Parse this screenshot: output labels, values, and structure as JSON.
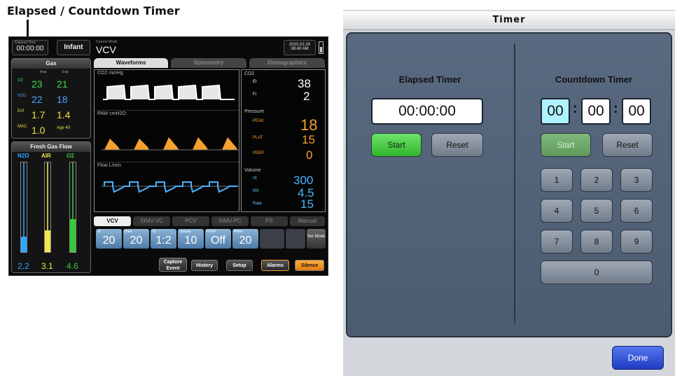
{
  "caption": "Elapsed / Countdown Timer",
  "ventilator": {
    "elapsed_label": "Elapsed Time",
    "elapsed": "00:00:00",
    "patient": "Infant",
    "current_mode_label": "Current Mode",
    "current_mode": "VCV",
    "date": "2015.02.24",
    "time": "08:40 AM",
    "gas": {
      "title": "Gas",
      "col_insp": "Insp",
      "col_exp": "Exp",
      "rows": [
        {
          "label": "O2",
          "insp": "23",
          "exp": "21"
        },
        {
          "label": "N2O",
          "insp": "22",
          "exp": "18"
        },
        {
          "label": "Enf",
          "insp": "1.7",
          "exp": "1.4"
        }
      ],
      "mac_label": "MAC",
      "mac": "1.0",
      "age_label": "Age",
      "age": "40"
    },
    "fresh_gas": {
      "title": "Fresh Gas Flow",
      "items": [
        {
          "name": "N2O",
          "value": "2.2",
          "color": "#2aa8ff",
          "level": 0.17
        },
        {
          "name": "AIR",
          "value": "3.1",
          "color": "#f2e64a",
          "level": 0.24
        },
        {
          "name": "O2",
          "value": "4.6",
          "color": "#38c93a",
          "level": 0.36
        }
      ]
    },
    "tabs": [
      "Waveforms",
      "Spirometry",
      "Demographics"
    ],
    "waves": [
      {
        "title": "CO2 mmHg"
      },
      {
        "title": "PAW cmH2O"
      },
      {
        "title": "Flow L/min"
      }
    ],
    "readings": {
      "co2_title": "CO2",
      "et_label": "Et",
      "et": "38",
      "fi_label": "Fi",
      "fi": "2",
      "pressure_title": "Pressure",
      "peak_label": "PEAK",
      "peak": "18",
      "plat_label": "PLAT",
      "plat": "15",
      "peep_label": "PEEP",
      "peep": "0",
      "volume_title": "Volume",
      "vt_label": "Vt",
      "vt": "300",
      "mv_label": "MV",
      "mv": "4.5",
      "rate_label": "Rate",
      "rate": "15"
    },
    "modes": [
      "VCV",
      "SIMV-VC",
      "PCV",
      "SIMV-PC",
      "PS",
      "Manual"
    ],
    "params": [
      {
        "label": "Vt",
        "value": "20"
      },
      {
        "label": "Rate",
        "value": "20"
      },
      {
        "label": "I:E",
        "value": "1:2"
      },
      {
        "label": "Tpause",
        "value": "10"
      },
      {
        "label": "PEEP",
        "value": "Off"
      },
      {
        "label": "Plimit",
        "value": "20"
      }
    ],
    "set_mode": "Set Mode",
    "buttons": {
      "capture": "Capture Event",
      "history": "History",
      "setup": "Setup",
      "alarms": "Alarms",
      "silence": "Silence"
    }
  },
  "timer_dialog": {
    "title": "Timer",
    "elapsed": {
      "title": "Elapsed Timer",
      "value": "00:00:00",
      "start": "Start",
      "reset": "Reset"
    },
    "countdown": {
      "title": "Countdown Timer",
      "hours": "00",
      "minutes": "00",
      "seconds": "00",
      "start": "Start",
      "reset": "Reset",
      "keys": [
        "1",
        "2",
        "3",
        "4",
        "5",
        "6",
        "7",
        "8",
        "9",
        "0"
      ]
    },
    "done": "Done"
  }
}
